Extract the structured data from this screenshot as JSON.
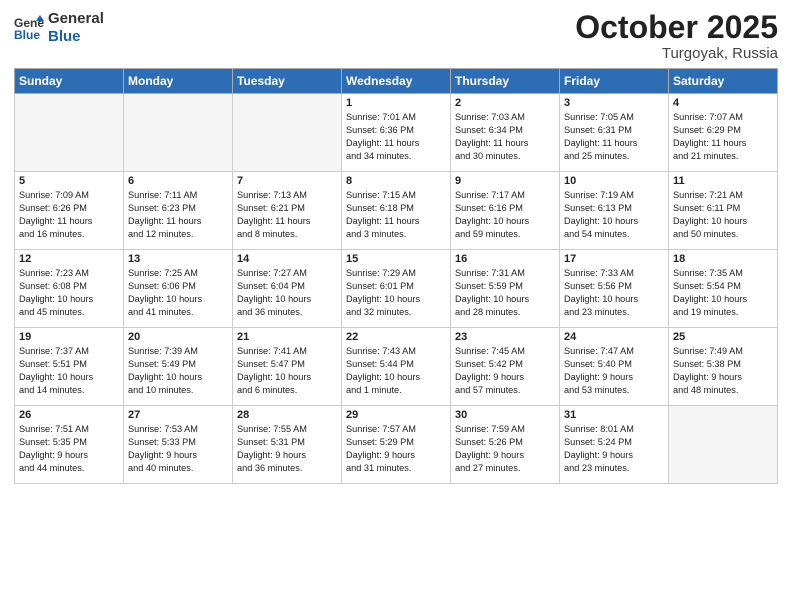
{
  "header": {
    "logo_line1": "General",
    "logo_line2": "Blue",
    "month": "October 2025",
    "location": "Turgoyak, Russia"
  },
  "days_of_week": [
    "Sunday",
    "Monday",
    "Tuesday",
    "Wednesday",
    "Thursday",
    "Friday",
    "Saturday"
  ],
  "weeks": [
    [
      {
        "day": "",
        "info": ""
      },
      {
        "day": "",
        "info": ""
      },
      {
        "day": "",
        "info": ""
      },
      {
        "day": "1",
        "info": "Sunrise: 7:01 AM\nSunset: 6:36 PM\nDaylight: 11 hours\nand 34 minutes."
      },
      {
        "day": "2",
        "info": "Sunrise: 7:03 AM\nSunset: 6:34 PM\nDaylight: 11 hours\nand 30 minutes."
      },
      {
        "day": "3",
        "info": "Sunrise: 7:05 AM\nSunset: 6:31 PM\nDaylight: 11 hours\nand 25 minutes."
      },
      {
        "day": "4",
        "info": "Sunrise: 7:07 AM\nSunset: 6:29 PM\nDaylight: 11 hours\nand 21 minutes."
      }
    ],
    [
      {
        "day": "5",
        "info": "Sunrise: 7:09 AM\nSunset: 6:26 PM\nDaylight: 11 hours\nand 16 minutes."
      },
      {
        "day": "6",
        "info": "Sunrise: 7:11 AM\nSunset: 6:23 PM\nDaylight: 11 hours\nand 12 minutes."
      },
      {
        "day": "7",
        "info": "Sunrise: 7:13 AM\nSunset: 6:21 PM\nDaylight: 11 hours\nand 8 minutes."
      },
      {
        "day": "8",
        "info": "Sunrise: 7:15 AM\nSunset: 6:18 PM\nDaylight: 11 hours\nand 3 minutes."
      },
      {
        "day": "9",
        "info": "Sunrise: 7:17 AM\nSunset: 6:16 PM\nDaylight: 10 hours\nand 59 minutes."
      },
      {
        "day": "10",
        "info": "Sunrise: 7:19 AM\nSunset: 6:13 PM\nDaylight: 10 hours\nand 54 minutes."
      },
      {
        "day": "11",
        "info": "Sunrise: 7:21 AM\nSunset: 6:11 PM\nDaylight: 10 hours\nand 50 minutes."
      }
    ],
    [
      {
        "day": "12",
        "info": "Sunrise: 7:23 AM\nSunset: 6:08 PM\nDaylight: 10 hours\nand 45 minutes."
      },
      {
        "day": "13",
        "info": "Sunrise: 7:25 AM\nSunset: 6:06 PM\nDaylight: 10 hours\nand 41 minutes."
      },
      {
        "day": "14",
        "info": "Sunrise: 7:27 AM\nSunset: 6:04 PM\nDaylight: 10 hours\nand 36 minutes."
      },
      {
        "day": "15",
        "info": "Sunrise: 7:29 AM\nSunset: 6:01 PM\nDaylight: 10 hours\nand 32 minutes."
      },
      {
        "day": "16",
        "info": "Sunrise: 7:31 AM\nSunset: 5:59 PM\nDaylight: 10 hours\nand 28 minutes."
      },
      {
        "day": "17",
        "info": "Sunrise: 7:33 AM\nSunset: 5:56 PM\nDaylight: 10 hours\nand 23 minutes."
      },
      {
        "day": "18",
        "info": "Sunrise: 7:35 AM\nSunset: 5:54 PM\nDaylight: 10 hours\nand 19 minutes."
      }
    ],
    [
      {
        "day": "19",
        "info": "Sunrise: 7:37 AM\nSunset: 5:51 PM\nDaylight: 10 hours\nand 14 minutes."
      },
      {
        "day": "20",
        "info": "Sunrise: 7:39 AM\nSunset: 5:49 PM\nDaylight: 10 hours\nand 10 minutes."
      },
      {
        "day": "21",
        "info": "Sunrise: 7:41 AM\nSunset: 5:47 PM\nDaylight: 10 hours\nand 6 minutes."
      },
      {
        "day": "22",
        "info": "Sunrise: 7:43 AM\nSunset: 5:44 PM\nDaylight: 10 hours\nand 1 minute."
      },
      {
        "day": "23",
        "info": "Sunrise: 7:45 AM\nSunset: 5:42 PM\nDaylight: 9 hours\nand 57 minutes."
      },
      {
        "day": "24",
        "info": "Sunrise: 7:47 AM\nSunset: 5:40 PM\nDaylight: 9 hours\nand 53 minutes."
      },
      {
        "day": "25",
        "info": "Sunrise: 7:49 AM\nSunset: 5:38 PM\nDaylight: 9 hours\nand 48 minutes."
      }
    ],
    [
      {
        "day": "26",
        "info": "Sunrise: 7:51 AM\nSunset: 5:35 PM\nDaylight: 9 hours\nand 44 minutes."
      },
      {
        "day": "27",
        "info": "Sunrise: 7:53 AM\nSunset: 5:33 PM\nDaylight: 9 hours\nand 40 minutes."
      },
      {
        "day": "28",
        "info": "Sunrise: 7:55 AM\nSunset: 5:31 PM\nDaylight: 9 hours\nand 36 minutes."
      },
      {
        "day": "29",
        "info": "Sunrise: 7:57 AM\nSunset: 5:29 PM\nDaylight: 9 hours\nand 31 minutes."
      },
      {
        "day": "30",
        "info": "Sunrise: 7:59 AM\nSunset: 5:26 PM\nDaylight: 9 hours\nand 27 minutes."
      },
      {
        "day": "31",
        "info": "Sunrise: 8:01 AM\nSunset: 5:24 PM\nDaylight: 9 hours\nand 23 minutes."
      },
      {
        "day": "",
        "info": ""
      }
    ]
  ]
}
